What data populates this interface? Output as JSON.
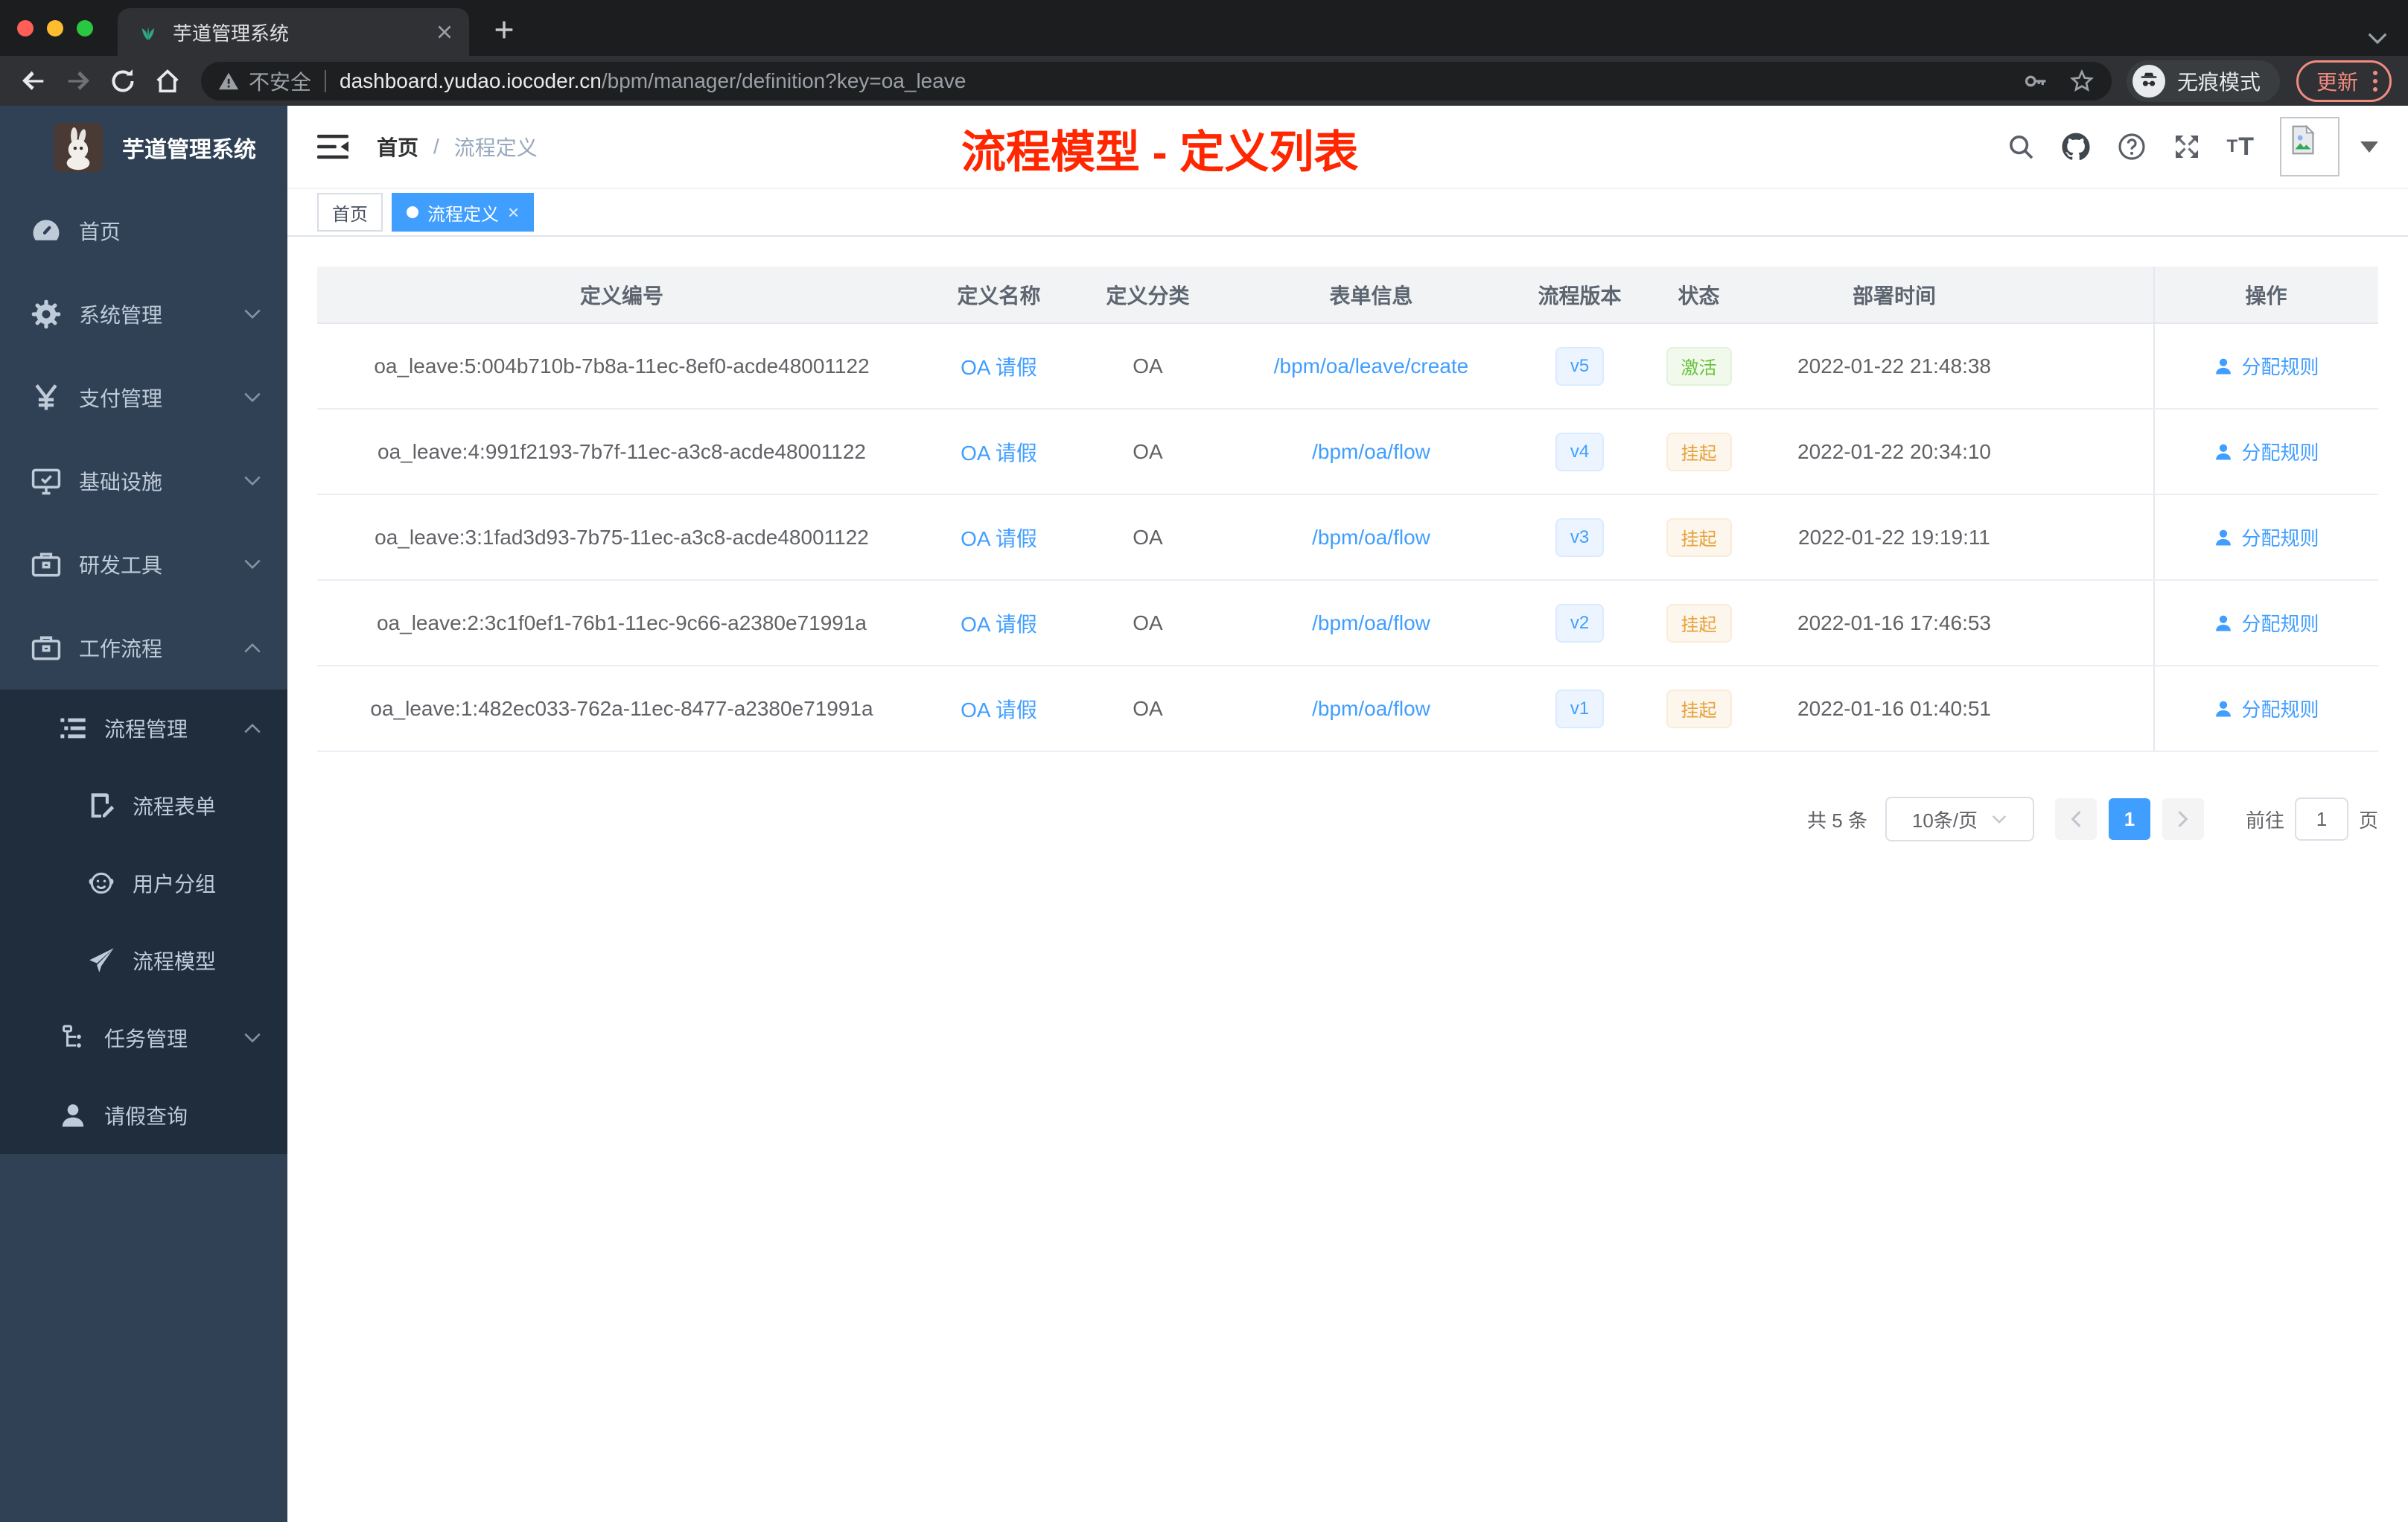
{
  "browser": {
    "tab": {
      "title": "芋道管理系统"
    },
    "address": {
      "security_label": "不安全",
      "url_domain": "dashboard.yudao.iocoder.cn",
      "url_path": "/bpm/manager/definition?key=oa_leave"
    },
    "incognito_label": "无痕模式",
    "update_label": "更新"
  },
  "annotation": {
    "text": "流程模型 - 定义列表"
  },
  "sidebar": {
    "app_title": "芋道管理系统",
    "items": [
      {
        "label": "首页"
      },
      {
        "label": "系统管理"
      },
      {
        "label": "支付管理"
      },
      {
        "label": "基础设施"
      },
      {
        "label": "研发工具"
      },
      {
        "label": "工作流程",
        "children": [
          {
            "label": "流程管理",
            "children": [
              {
                "label": "流程表单"
              },
              {
                "label": "用户分组"
              },
              {
                "label": "流程模型"
              }
            ]
          },
          {
            "label": "任务管理"
          },
          {
            "label": "请假查询"
          }
        ]
      }
    ]
  },
  "header": {
    "breadcrumb": {
      "home": "首页",
      "separator": "/",
      "current": "流程定义"
    }
  },
  "tags": [
    {
      "label": "首页"
    },
    {
      "label": "流程定义"
    }
  ],
  "table": {
    "headers": [
      "定义编号",
      "定义名称",
      "定义分类",
      "表单信息",
      "流程版本",
      "状态",
      "部署时间",
      "操作"
    ],
    "rows": [
      {
        "id": "oa_leave:5:004b710b-7b8a-11ec-8ef0-acde48001122",
        "name": "OA 请假",
        "category": "OA",
        "form": "/bpm/oa/leave/create",
        "version": "v5",
        "status": "激活",
        "status_type": "success",
        "time": "2022-01-22 21:48:38",
        "action": "分配规则"
      },
      {
        "id": "oa_leave:4:991f2193-7b7f-11ec-a3c8-acde48001122",
        "name": "OA 请假",
        "category": "OA",
        "form": "/bpm/oa/flow",
        "version": "v4",
        "status": "挂起",
        "status_type": "warning",
        "time": "2022-01-22 20:34:10",
        "action": "分配规则"
      },
      {
        "id": "oa_leave:3:1fad3d93-7b75-11ec-a3c8-acde48001122",
        "name": "OA 请假",
        "category": "OA",
        "form": "/bpm/oa/flow",
        "version": "v3",
        "status": "挂起",
        "status_type": "warning",
        "time": "2022-01-22 19:19:11",
        "action": "分配规则"
      },
      {
        "id": "oa_leave:2:3c1f0ef1-76b1-11ec-9c66-a2380e71991a",
        "name": "OA 请假",
        "category": "OA",
        "form": "/bpm/oa/flow",
        "version": "v2",
        "status": "挂起",
        "status_type": "warning",
        "time": "2022-01-16 17:46:53",
        "action": "分配规则"
      },
      {
        "id": "oa_leave:1:482ec033-762a-11ec-8477-a2380e71991a",
        "name": "OA 请假",
        "category": "OA",
        "form": "/bpm/oa/flow",
        "version": "v1",
        "status": "挂起",
        "status_type": "warning",
        "time": "2022-01-16 01:40:51",
        "action": "分配规则"
      }
    ]
  },
  "pagination": {
    "total": "共 5 条",
    "page_size": "10条/页",
    "current_page": "1",
    "goto_label": "前往",
    "goto_value": "1",
    "page_unit": "页"
  },
  "colors": {
    "accent": "#409eff",
    "success": "#67c23a",
    "warning": "#e6a23c",
    "annotation_red": "#ff2600",
    "sidebar_bg": "#304156",
    "submenu_bg": "#1f2d3d"
  }
}
